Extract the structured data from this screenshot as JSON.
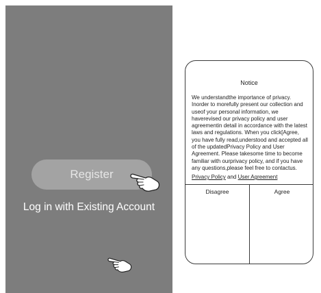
{
  "register_screen": {
    "register_label": "Register",
    "login_label": "Log in with Existing Account"
  },
  "notice": {
    "title": "Notice",
    "body": "We understandthe importance of privacy. Inorder to morefully present our collection and useof your personal information, we haverevised our privacy policy and user agreementin detail in accordance with the latest laws and regulations. When you click[Agree, you have fully read,understood and accepted all of the updatedPrivacy Policy and User Agreement. Please takesome time to become familiar with ourprivacy policy, and if you have any questions,please feel free to contactus.",
    "privacy_policy_link": "Privacy Policy",
    "and_text": "and",
    "user_agreement_link": "User Agreement",
    "disagree_label": "Disagree",
    "agree_label": "Agree"
  },
  "colors": {
    "phone_background": "#7d7d7d",
    "register_button": "#a3a3a3"
  },
  "icons": [
    "pointing-hand-icon"
  ]
}
